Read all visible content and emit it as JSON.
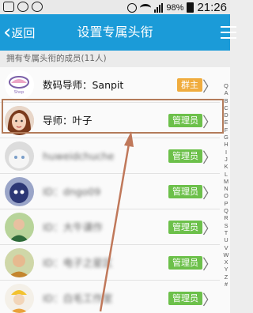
{
  "status_bar": {
    "battery": "98%",
    "time": "21:26"
  },
  "nav": {
    "back_label": "返回",
    "title": "设置专属头衔"
  },
  "section_header": "拥有专属头衔的成员(11人)",
  "members": [
    {
      "label": "数码导师：Sanpit",
      "badge": "群主",
      "badge_color": "#f0ac3e",
      "blurred": false
    },
    {
      "label": "导师：叶子",
      "badge": "管理员",
      "badge_color": "#6cc04a",
      "blurred": false
    },
    {
      "label": "huweidchuche",
      "badge": "管理员",
      "badge_color": "#6cc04a",
      "blurred": true
    },
    {
      "label": "ID：dngo09",
      "badge": "管理员",
      "badge_color": "#6cc04a",
      "blurred": true
    },
    {
      "label": "ID：大牛课作",
      "badge": "管理员",
      "badge_color": "#6cc04a",
      "blurred": true
    },
    {
      "label": "ID：电子之星区",
      "badge": "管理员",
      "badge_color": "#6cc04a",
      "blurred": true
    },
    {
      "label": "ID：白毛工作室",
      "badge": "管理员",
      "badge_color": "#6cc04a",
      "blurred": true
    }
  ],
  "index_letters": [
    "Q",
    "A",
    "B",
    "C",
    "D",
    "E",
    "F",
    "G",
    "H",
    "I",
    "J",
    "K",
    "L",
    "M",
    "N",
    "O",
    "P",
    "Q",
    "R",
    "S",
    "T",
    "U",
    "V",
    "W",
    "X",
    "Y",
    "Z",
    "#"
  ],
  "icons": [
    "back-arrow-icon",
    "menu-icon",
    "chevron-right-icon",
    "alarm-icon",
    "wifi-icon",
    "signal-icon",
    "battery-icon"
  ]
}
